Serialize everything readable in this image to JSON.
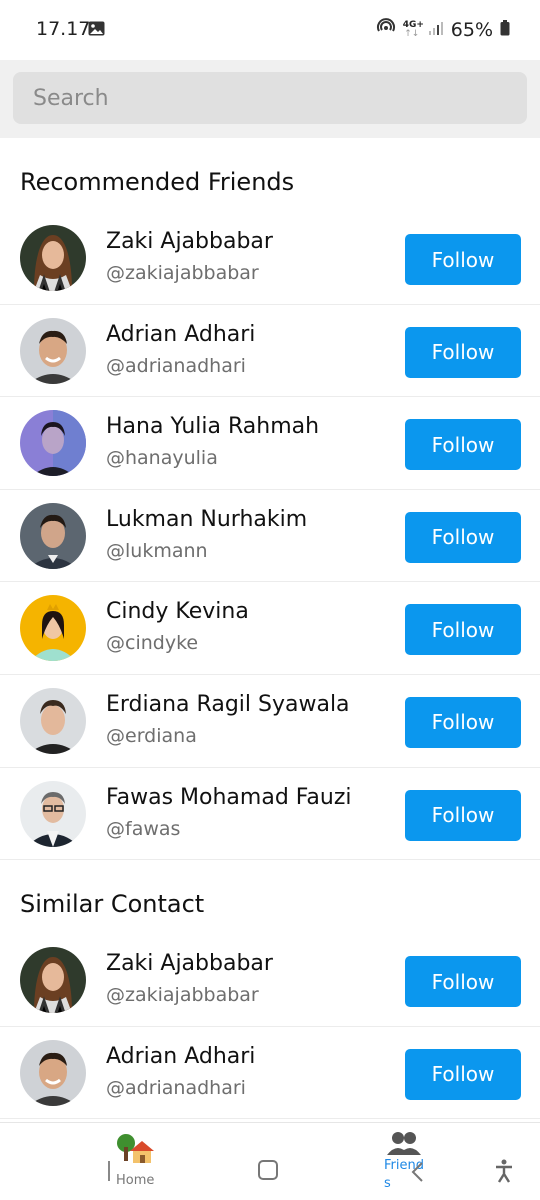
{
  "status": {
    "time": "17.17",
    "network": "4G+",
    "battery": "65%",
    "icons": [
      "gallery-icon",
      "hotspot-icon",
      "network-4g-icon",
      "signal-icon",
      "battery-icon"
    ]
  },
  "search": {
    "placeholder": "Search"
  },
  "recommended": {
    "title": "Recommended Friends",
    "items": [
      {
        "name": "Zaki Ajabbabar",
        "handle": "@zakiajabbabar",
        "button": "Follow"
      },
      {
        "name": "Adrian Adhari",
        "handle": "@adrianadhari",
        "button": "Follow"
      },
      {
        "name": "Hana Yulia Rahmah",
        "handle": "@hanayulia",
        "button": "Follow"
      },
      {
        "name": "Lukman Nurhakim",
        "handle": "@lukmann",
        "button": "Follow"
      },
      {
        "name": "Cindy Kevina",
        "handle": "@cindyke",
        "button": "Follow"
      },
      {
        "name": "Erdiana Ragil Syawala",
        "handle": "@erdiana",
        "button": "Follow"
      },
      {
        "name": "Fawas Mohamad Fauzi",
        "handle": "@fawas",
        "button": "Follow"
      }
    ]
  },
  "similar": {
    "title": "Similar Contact",
    "items": [
      {
        "name": "Zaki Ajabbabar",
        "handle": "@zakiajabbabar",
        "button": "Follow"
      },
      {
        "name": "Adrian Adhari",
        "handle": "@adrianadhari",
        "button": "Follow"
      }
    ]
  },
  "nav": {
    "home_label": "Home",
    "friends_label": "Friends"
  },
  "colors": {
    "accent": "#0b97ee",
    "friends_active": "#1e88e5",
    "search_band": "#f0f0f0",
    "search_field": "#e0e0e0"
  }
}
